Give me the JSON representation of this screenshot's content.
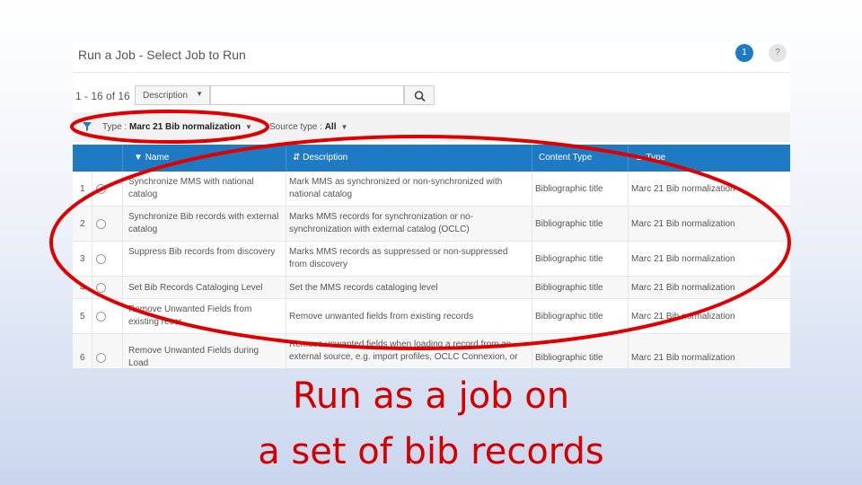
{
  "header": {
    "title": "Run a Job - Select Job to Run",
    "step_badge": "1",
    "help_badge": "?"
  },
  "toolbar": {
    "record_count": "1 - 16 of 16",
    "search_field_label": "Description",
    "search_value": "",
    "search_icon": "search-icon"
  },
  "filters": {
    "type_label": "Type :",
    "type_value": "Marc 21 Bib normalization",
    "source_label": "Source type :",
    "source_value": "All"
  },
  "table": {
    "columns": [
      {
        "label": "Name",
        "sort": "▼"
      },
      {
        "label": "Description",
        "sort": "⇵"
      },
      {
        "label": "Content Type",
        "sort": ""
      },
      {
        "label": "Type",
        "sort": "▲"
      }
    ],
    "rows": [
      {
        "num": "1",
        "name": "Synchronize MMS with national catalog",
        "description": "Mark MMS as synchronized or non-synchronized with national catalog",
        "content_type": "Bibliographic title",
        "type": "Marc 21 Bib normalization"
      },
      {
        "num": "2",
        "name": "Synchronize Bib records with external catalog",
        "description": "Marks MMS records for synchronization or no-synchronization with external catalog (OCLC)",
        "content_type": "Bibliographic title",
        "type": "Marc 21 Bib normalization"
      },
      {
        "num": "3",
        "name": "Suppress Bib records from discovery",
        "description": "Marks MMS records as suppressed or non-suppressed from discovery",
        "content_type": "Bibliographic title",
        "type": "Marc 21 Bib normalization"
      },
      {
        "num": "4",
        "name": "Set Bib Records Cataloging Level",
        "description": "Set the MMS records cataloging level",
        "content_type": "Bibliographic title",
        "type": "Marc 21 Bib normalization"
      },
      {
        "num": "5",
        "name": "Remove Unwanted Fields from existing recor",
        "description": "Remove unwanted fields from existing records",
        "content_type": "Bibliographic title",
        "type": "Marc 21 Bib normalization"
      },
      {
        "num": "6",
        "name": "Remove Unwanted Fields during Load",
        "description": "Remove unwanted fields when loading a record from an external source, e.g. import profiles, OCLC Connexion, or",
        "content_type": "Bibliographic title",
        "type": "Marc 21 Bib normalization"
      }
    ]
  },
  "caption": {
    "line1": "Run as a job on",
    "line2": "a set of bib records"
  },
  "colors": {
    "accent": "#1f7ac4",
    "annotation": "#e00000",
    "caption": "#d40000"
  }
}
